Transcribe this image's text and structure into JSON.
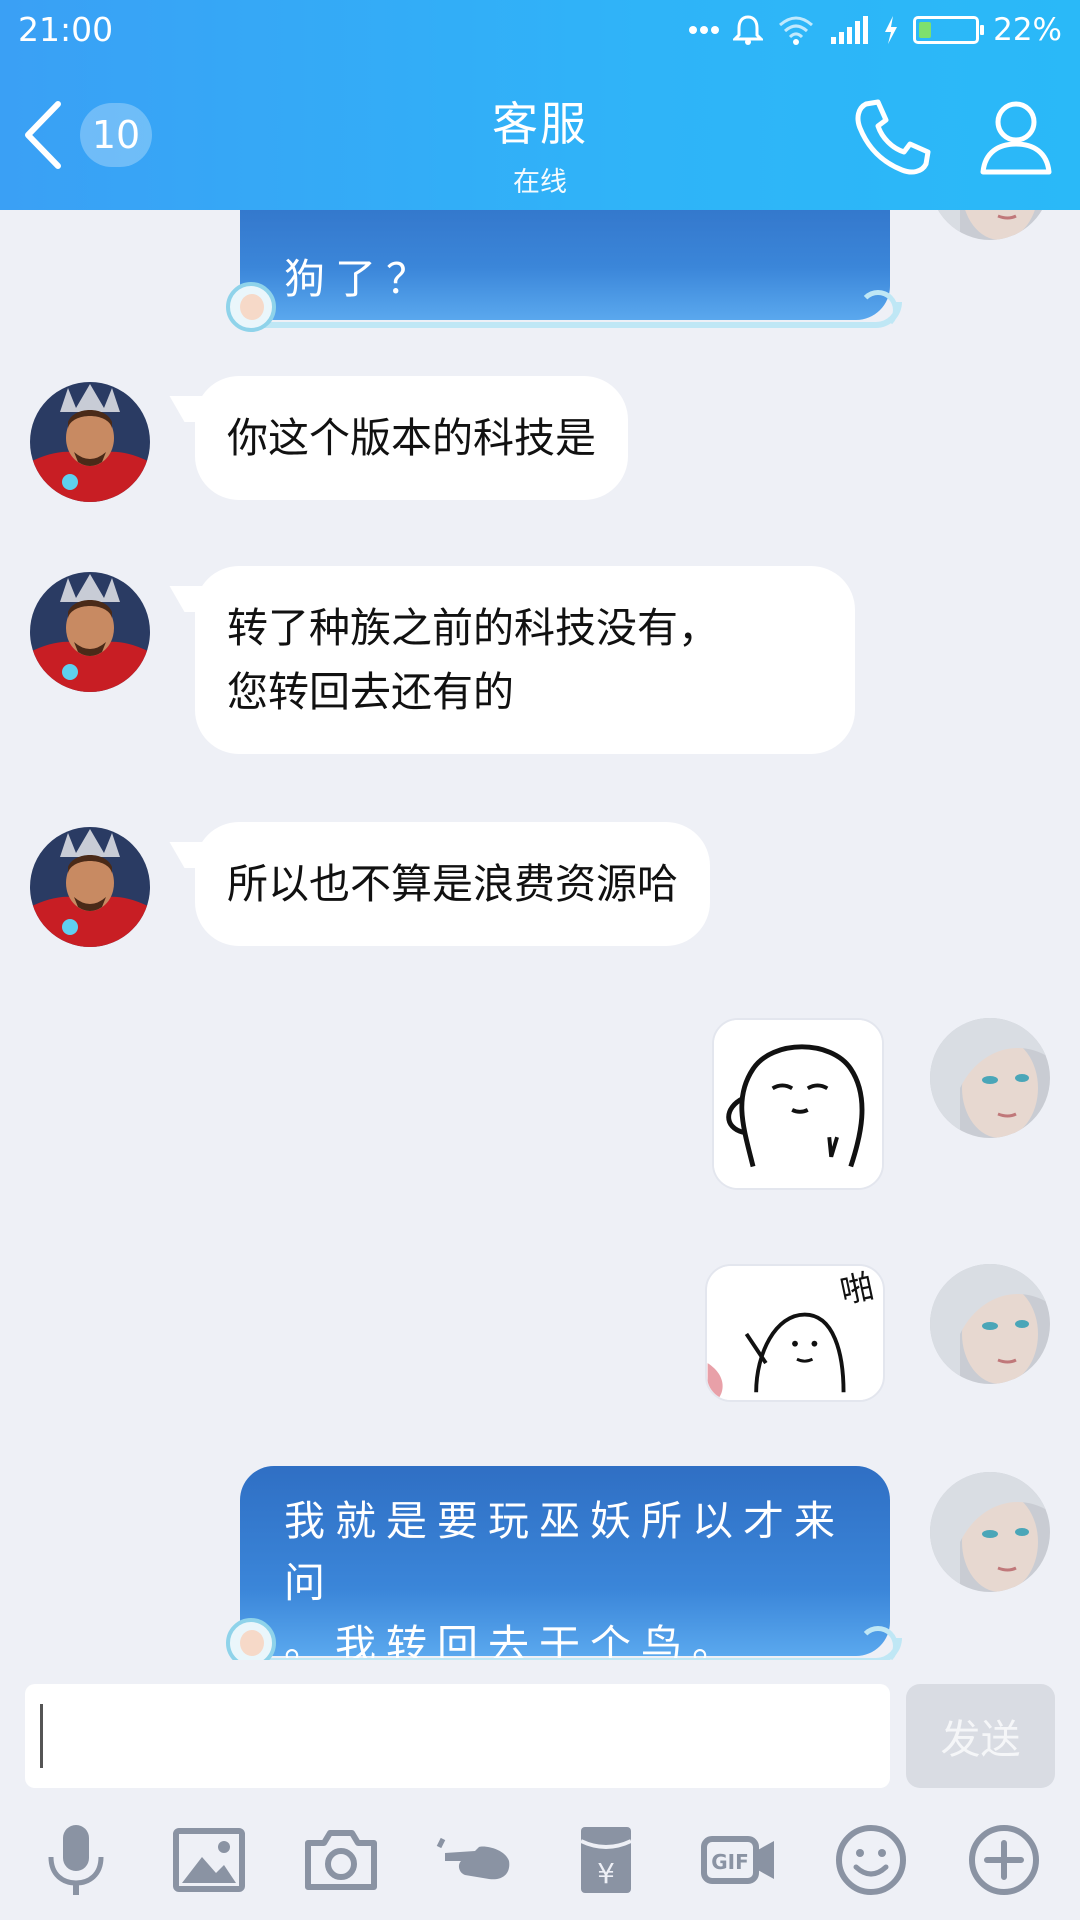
{
  "status_bar": {
    "time": "21:00",
    "battery_pct": "22%",
    "battery_level": 0.22
  },
  "header": {
    "unread_count": "10",
    "title": "客服",
    "subtitle": "在线"
  },
  "messages": [
    {
      "side": "right",
      "style": "blue",
      "text": "狗了？"
    },
    {
      "side": "left",
      "style": "white",
      "text": "你这个版本的科技是"
    },
    {
      "side": "left",
      "style": "white",
      "line1": "转了种族之前的科技没有，",
      "line2": "您转回去还有的"
    },
    {
      "side": "left",
      "style": "white",
      "text": "所以也不算是浪费资源哈"
    },
    {
      "side": "right",
      "style": "sticker",
      "sticker": "bear-face-sticker"
    },
    {
      "side": "right",
      "style": "sticker",
      "sticker": "clapping-sticker"
    },
    {
      "side": "right",
      "style": "blue",
      "line1": "我就是要玩巫妖所以才来问",
      "line2": "。我转回去干个鸟。"
    }
  ],
  "input": {
    "value": "",
    "placeholder": ""
  },
  "send_label": "发送",
  "sticker_text": "啪",
  "toolbar": [
    "microphone-icon",
    "image-icon",
    "camera-icon",
    "poke-icon",
    "red-packet-icon",
    "gif-icon",
    "emoji-icon",
    "plus-icon"
  ],
  "colors": {
    "header": "#2fb4f8",
    "blue_bubble": "#3b86d9",
    "background": "#eef0f6"
  }
}
